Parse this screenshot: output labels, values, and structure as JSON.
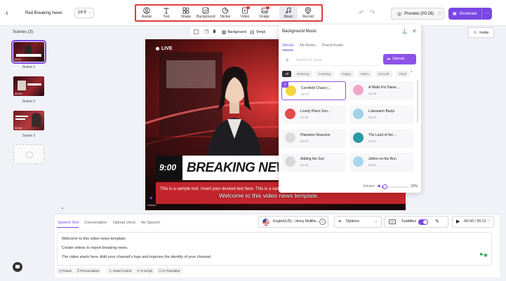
{
  "header": {
    "back_icon": "chevron-left-icon",
    "project_title": "Red Breaking News",
    "ratio": "16:9",
    "tools": [
      {
        "label": "Avatar",
        "icon": "avatar-icon"
      },
      {
        "label": "Text",
        "icon": "text-icon"
      },
      {
        "label": "Shape",
        "icon": "shape-icon"
      },
      {
        "label": "Background",
        "icon": "background-icon"
      },
      {
        "label": "Sticker",
        "icon": "sticker-icon"
      },
      {
        "label": "Video",
        "icon": "video-icon"
      },
      {
        "label": "Image",
        "icon": "image-icon"
      },
      {
        "label": "Music",
        "icon": "music-icon"
      },
      {
        "label": "Record",
        "icon": "record-icon"
      }
    ],
    "preview_label": "Preview (00:26)",
    "generate_label": "Generate",
    "more_label": "···",
    "accent": "#7b46e4"
  },
  "scenes": {
    "title": "Scenes (3)",
    "items": [
      {
        "label": "Scene 1",
        "time": "00:11"
      },
      {
        "label": "Scene 2",
        "time": "00:09"
      },
      {
        "label": "Scene 3",
        "time": "00:06"
      }
    ]
  },
  "canvas": {
    "tools_background_label": "Background",
    "tools_template_label": "Templ",
    "invite_label": "Invite"
  },
  "video": {
    "live": "LIVE",
    "time": "9:00",
    "headline": "BREAKING NEWS",
    "ticker": "This is a sample text. Insert your desired text here. This is a sample text. Insert your desir",
    "caption": "Welcome to this video news template.",
    "corner_label": "Videos"
  },
  "music_panel": {
    "title": "Background Music",
    "tabs": [
      "Stocks",
      "My Audio",
      "Brand Audio"
    ],
    "search_placeholder": "Search for music",
    "upload_label": "Upload",
    "chips": [
      "All",
      "Relaxing",
      "Inspiring",
      "Happy",
      "Warm",
      "Smooth",
      "Playf"
    ],
    "tracks": [
      {
        "name": "Cornfield Chase (...",
        "duration": "02:17",
        "color": "#f5d43c",
        "selected": true
      },
      {
        "name": "A Waltz For Naise...",
        "duration": "01:39",
        "color": "#f2a5c9",
        "selected": false
      },
      {
        "name": "Lovely Piano Son...",
        "duration": "01:30",
        "color": "#e34a4a",
        "selected": false
      },
      {
        "name": "Lukewarm Banjo",
        "duration": "00:32",
        "color": "#9ed1e8",
        "selected": false
      },
      {
        "name": "Planeteer Reaction",
        "duration": "04:00",
        "color": "#dcdcdc",
        "selected": false
      },
      {
        "name": "The Land of the ...",
        "duration": "01:47",
        "color": "#2c9ba3",
        "selected": false
      },
      {
        "name": "Adding the Sun",
        "duration": "02:16",
        "color": "#d8d8d8",
        "selected": false
      },
      {
        "name": "Jethro on the Run",
        "duration": "02:51",
        "color": "#a9d7ec",
        "selected": false
      }
    ],
    "volume_label": "Volume",
    "volume_value": "10%",
    "volume_fraction": 0.1
  },
  "bottom": {
    "tabs": [
      "Speech Text",
      "Conversation",
      "Upload Voice",
      "No Speech"
    ],
    "voice": "English(US) - Jenny Multilin...",
    "options_label": "Options",
    "subtitles_label": "Subtitles",
    "player_time": "00:00 / 00:11",
    "script_lines": [
      "Welcome to this video news template.",
      "Create videos to report breaking news.",
      "The video starts here. Add your channel's logo and improve the identity of your channel."
    ],
    "footer_buttons": [
      "Pause",
      "Pronunciation",
      "Head Control",
      "AI Script",
      "AI Translator"
    ]
  }
}
